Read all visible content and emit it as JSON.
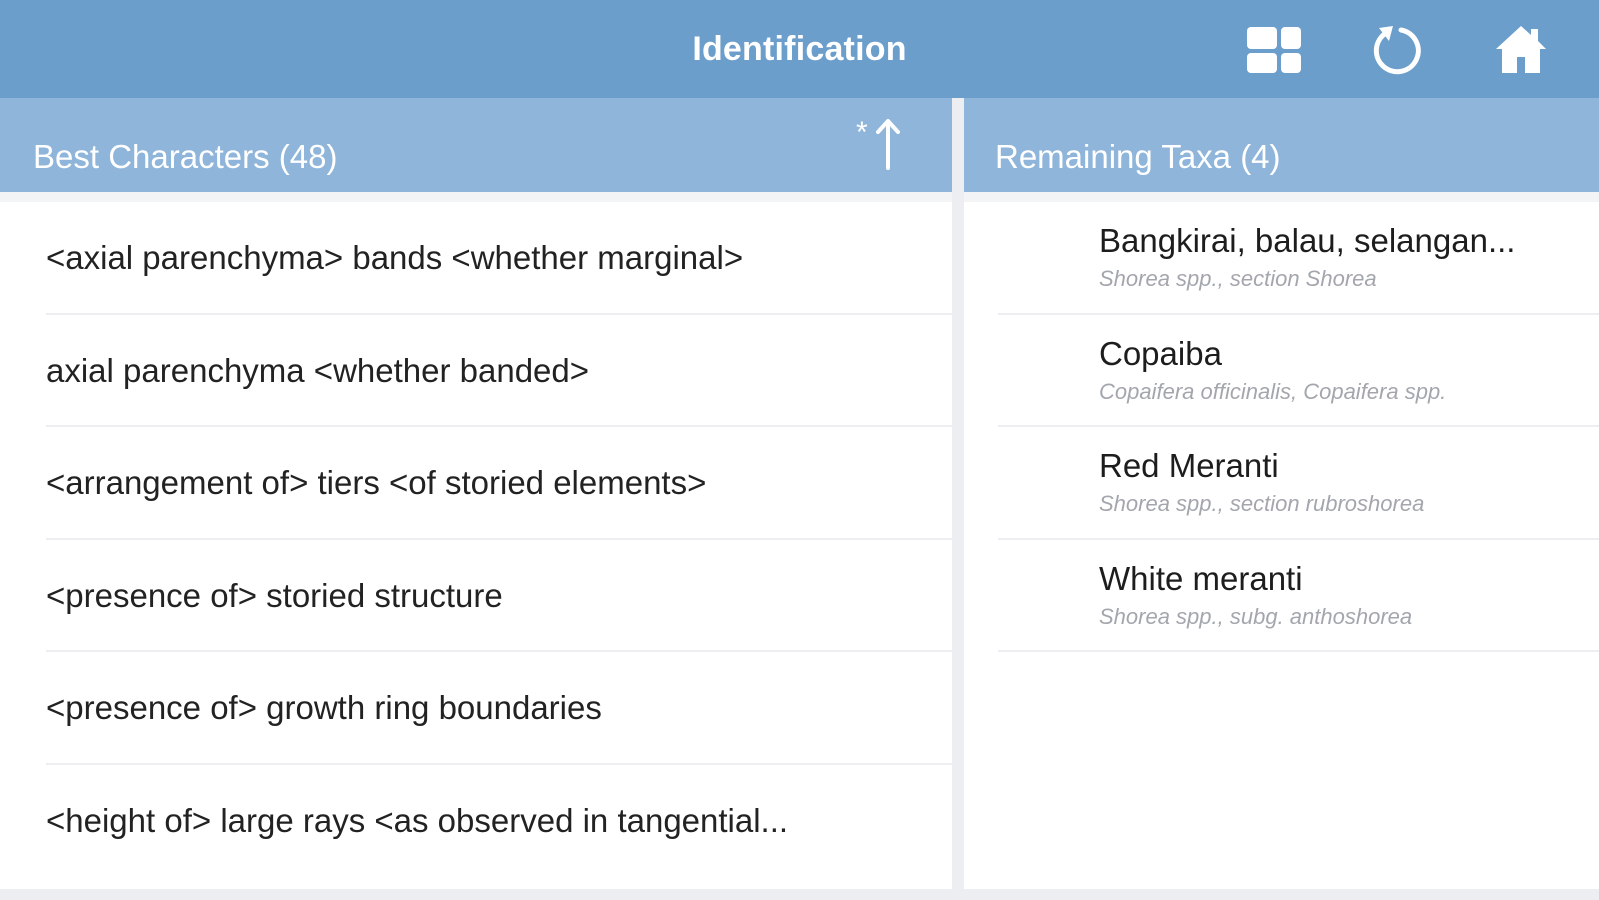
{
  "navbar": {
    "title": "Identification",
    "icons": [
      "grid-icon",
      "refresh-icon",
      "home-icon"
    ]
  },
  "colors": {
    "navbar": "#6b9ecb",
    "section_header": "#8fb5da",
    "background": "#eceef2"
  },
  "best_characters": {
    "header": "Best Characters  (48)",
    "sort_indicator": "*",
    "items": [
      "<axial parenchyma> bands <whether marginal>",
      "axial parenchyma <whether banded>",
      "<arrangement of> tiers <of storied elements>",
      "<presence of> storied structure",
      "<presence of> growth ring boundaries",
      "<height of> large rays <as observed in tangential..."
    ]
  },
  "remaining_taxa": {
    "header": "Remaining Taxa  (4)",
    "items": [
      {
        "name": "Bangkirai, balau, selangan...",
        "scientific": "Shorea spp., section Shorea"
      },
      {
        "name": "Copaiba",
        "scientific": "Copaifera officinalis, Copaifera spp."
      },
      {
        "name": "Red Meranti",
        "scientific": "Shorea spp., section rubroshorea"
      },
      {
        "name": "White meranti",
        "scientific": "Shorea spp., subg. anthoshorea"
      }
    ]
  }
}
